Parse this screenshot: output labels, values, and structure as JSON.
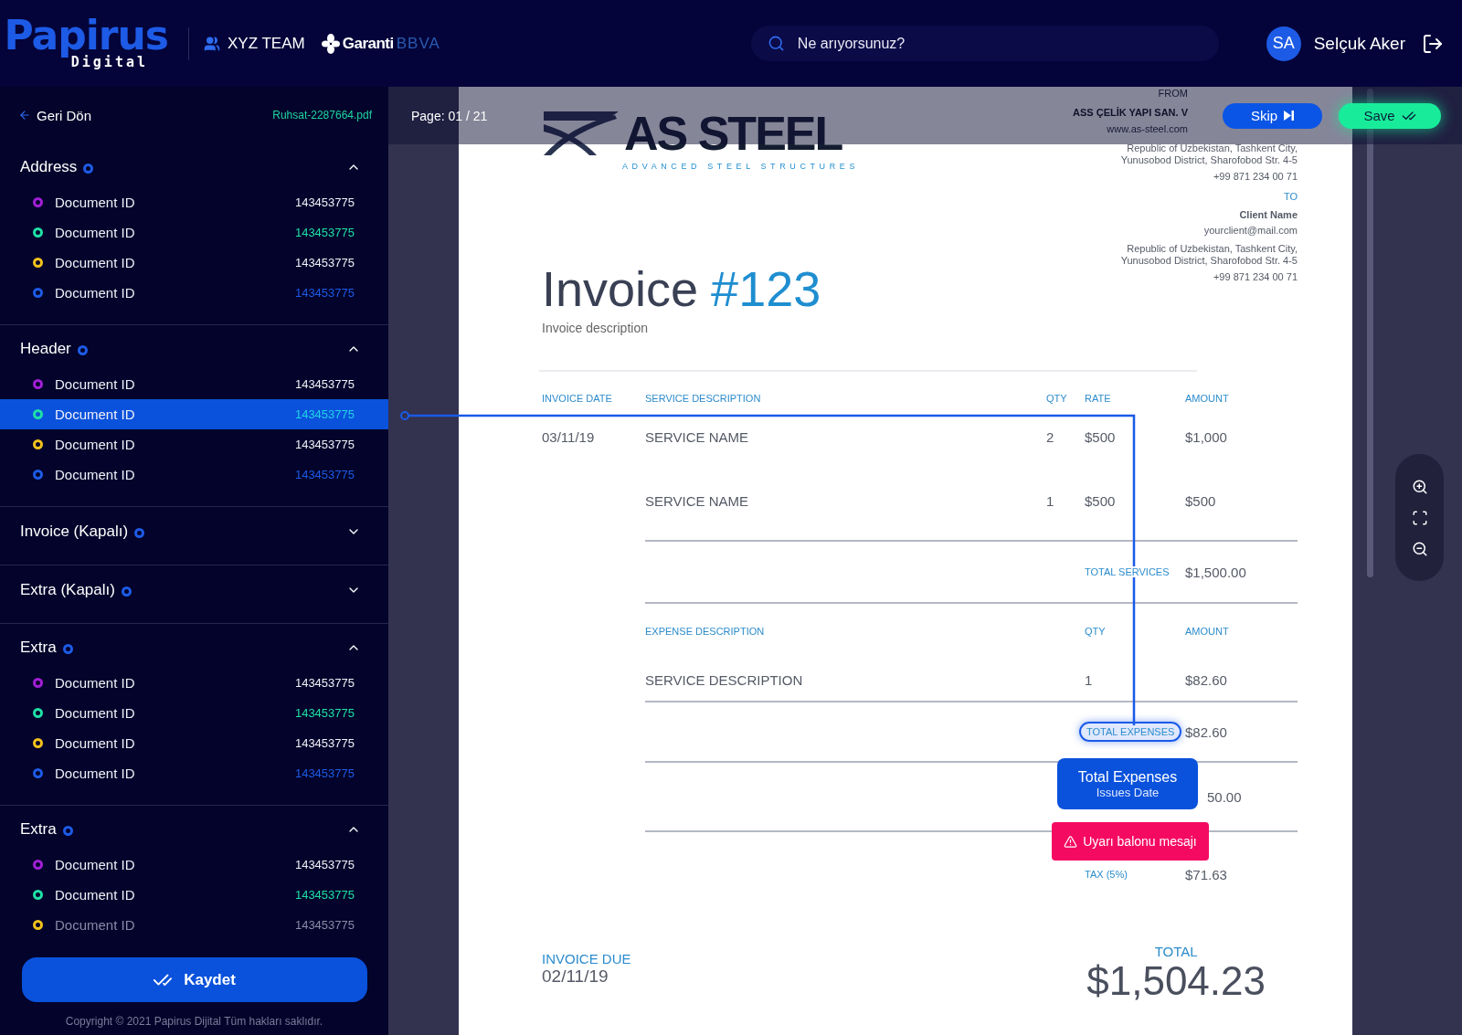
{
  "header": {
    "logo": {
      "word": "Papirus",
      "subtitle": "Digital"
    },
    "team": "XYZ TEAM",
    "bank": {
      "name": "Garanti",
      "suffix": "BBVA"
    },
    "search": {
      "placeholder": "Ne arıyorsunuz?"
    },
    "user": {
      "initials": "SA",
      "name": "Selçuk Aker"
    }
  },
  "sidebar": {
    "back": "Geri Dön",
    "file": "Ruhsat-2287664.pdf",
    "sections": [
      {
        "title": "Address",
        "expanded": true,
        "items": [
          {
            "label": "Document ID",
            "value": "143453775",
            "color": "#a21fd6",
            "tinted": false,
            "selected": false
          },
          {
            "label": "Document ID",
            "value": "143453775",
            "color": "#1fe0a6",
            "tinted": true,
            "selected": false
          },
          {
            "label": "Document ID",
            "value": "143453775",
            "color": "#f2c21b",
            "tinted": false,
            "selected": false
          },
          {
            "label": "Document ID",
            "value": "143453775",
            "color": "#1d5be6",
            "tinted": true,
            "selected": false
          }
        ]
      },
      {
        "title": "Header",
        "expanded": true,
        "items": [
          {
            "label": "Document ID",
            "value": "143453775",
            "color": "#a21fd6",
            "tinted": false,
            "selected": false
          },
          {
            "label": "Document ID",
            "value": "143453775",
            "color": "#1fe0a6",
            "tinted": true,
            "selected": true
          },
          {
            "label": "Document ID",
            "value": "143453775",
            "color": "#f2c21b",
            "tinted": false,
            "selected": false
          },
          {
            "label": "Document ID",
            "value": "143453775",
            "color": "#1d5be6",
            "tinted": true,
            "selected": false
          }
        ]
      },
      {
        "title": "Invoice (Kapalı)",
        "expanded": false
      },
      {
        "title": "Extra (Kapalı)",
        "expanded": false
      },
      {
        "title": "Extra",
        "expanded": true,
        "items": [
          {
            "label": "Document ID",
            "value": "143453775",
            "color": "#a21fd6",
            "tinted": false,
            "selected": false
          },
          {
            "label": "Document ID",
            "value": "143453775",
            "color": "#1fe0a6",
            "tinted": true,
            "selected": false
          },
          {
            "label": "Document ID",
            "value": "143453775",
            "color": "#f2c21b",
            "tinted": false,
            "selected": false
          },
          {
            "label": "Document ID",
            "value": "143453775",
            "color": "#1d5be6",
            "tinted": true,
            "selected": false
          }
        ]
      },
      {
        "title": "Extra",
        "expanded": true,
        "items": [
          {
            "label": "Document ID",
            "value": "143453775",
            "color": "#a21fd6",
            "tinted": false,
            "selected": false
          },
          {
            "label": "Document ID",
            "value": "143453775",
            "color": "#1fe0a6",
            "tinted": true,
            "selected": false
          },
          {
            "label": "Document ID",
            "value": "143453775",
            "color": "#f2c21b",
            "tinted": false,
            "selected": false
          }
        ]
      }
    ],
    "save_button": "Kaydet",
    "copyright": "Copyright © 2021 Papirus Dijital Tüm hakları saklıdır."
  },
  "viewer": {
    "page": "Page: 01 / 21",
    "skip_button": "Skip",
    "save_button": "Save",
    "invoice": {
      "company": {
        "name": "AS STEEL",
        "tagline": "ADVANCED STEEL STRUCTURES"
      },
      "from": {
        "label": "FROM",
        "name": "ASS ÇELİK YAPI SAN. V",
        "web": "www.as-steel.com",
        "address": [
          "Republic of Uzbekistan, Tashkent City,",
          "Yunusobod District, Sharofobod Str. 4-5"
        ],
        "phone": "+99 871 234 00 71"
      },
      "to": {
        "label": "TO",
        "name": "Client Name",
        "email": "yourclient@mail.com",
        "address": [
          "Republic of Uzbekistan, Tashkent City,",
          "Yunusobod District, Sharofobod Str. 4-5"
        ],
        "phone": "+99 871 234 00 71"
      },
      "title": "Invoice",
      "number": "#123",
      "description": "Invoice description",
      "services": {
        "columns": [
          "INVOICE DATE",
          "SERVICE DESCRIPTION",
          "QTY",
          "RATE",
          "AMOUNT"
        ],
        "rows": [
          {
            "date": "03/11/19",
            "description": "SERVICE NAME",
            "qty": "2",
            "rate": "$500",
            "amount": "$1,000"
          },
          {
            "description": "SERVICE NAME",
            "qty": "1",
            "rate": "$500",
            "amount": "$500"
          }
        ]
      },
      "total_services": {
        "label": "TOTAL SERVICES",
        "amount": "$1,500.00"
      },
      "expenses": {
        "columns": [
          "EXPENSE DESCRIPTION",
          "QTY",
          "AMOUNT"
        ],
        "rows": [
          {
            "description": "SERVICE DESCRIPTION",
            "qty": "1",
            "amount": "$82.60"
          }
        ]
      },
      "total_expenses": {
        "label": "TOTAL EXPENSES",
        "amount": "$82.60",
        "highlighted": true
      },
      "subtotal": {
        "amount": "50.00"
      },
      "tax": {
        "label": "TAX (5%)",
        "amount": "$71.63"
      },
      "due": {
        "label": "INVOICE DUE",
        "date": "02/11/19"
      },
      "total": {
        "label": "TOTAL",
        "amount": "$1,504.23"
      }
    },
    "tooltip": {
      "title": "Total Expenses",
      "subtitle": "Issues Date"
    },
    "warning": "Uyarı balonu mesajı"
  }
}
